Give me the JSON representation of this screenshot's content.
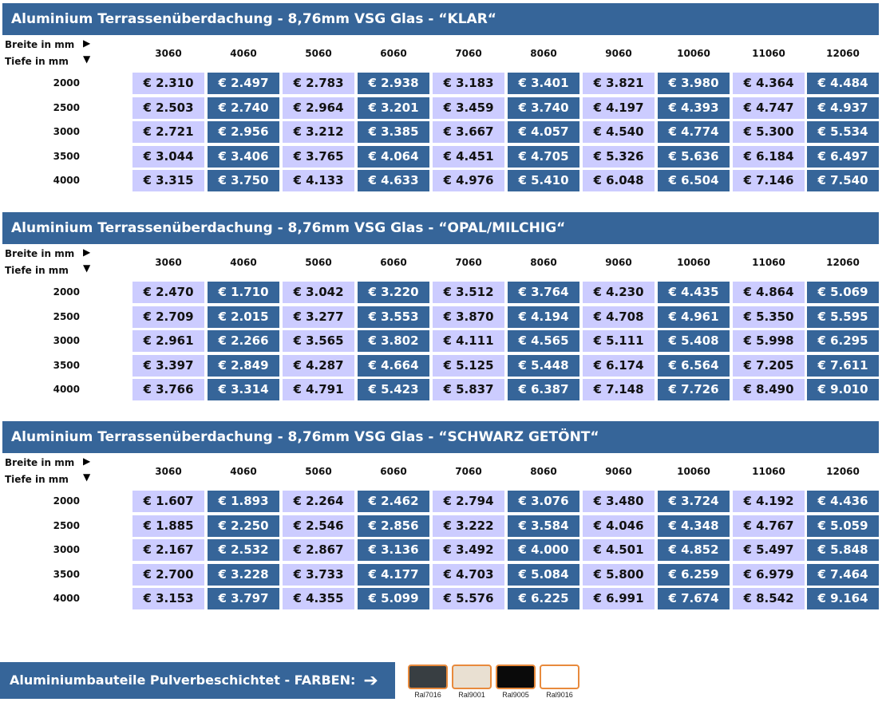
{
  "sections": [
    {
      "title": "Aluminium Terrassenüberdachung - 8,76mm VSG Glas - “KLAR“",
      "breite_label": "Breite in mm",
      "tiefe_label": "Tiefe in mm",
      "widths": [
        "3060",
        "4060",
        "5060",
        "6060",
        "7060",
        "8060",
        "9060",
        "10060",
        "11060",
        "12060"
      ],
      "rows": [
        {
          "depth": "2000",
          "prices": [
            "€ 2.310",
            "€ 2.497",
            "€ 2.783",
            "€ 2.938",
            "€ 3.183",
            "€ 3.401",
            "€ 3.821",
            "€ 3.980",
            "€ 4.364",
            "€ 4.484"
          ]
        },
        {
          "depth": "2500",
          "prices": [
            "€ 2.503",
            "€ 2.740",
            "€ 2.964",
            "€ 3.201",
            "€ 3.459",
            "€ 3.740",
            "€ 4.197",
            "€ 4.393",
            "€ 4.747",
            "€ 4.937"
          ]
        },
        {
          "depth": "3000",
          "prices": [
            "€ 2.721",
            "€ 2.956",
            "€ 3.212",
            "€ 3.385",
            "€ 3.667",
            "€ 4.057",
            "€ 4.540",
            "€ 4.774",
            "€ 5.300",
            "€ 5.534"
          ]
        },
        {
          "depth": "3500",
          "prices": [
            "€ 3.044",
            "€ 3.406",
            "€ 3.765",
            "€ 4.064",
            "€ 4.451",
            "€ 4.705",
            "€ 5.326",
            "€ 5.636",
            "€ 6.184",
            "€ 6.497"
          ]
        },
        {
          "depth": "4000",
          "prices": [
            "€ 3.315",
            "€ 3.750",
            "€ 4.133",
            "€ 4.633",
            "€ 4.976",
            "€ 5.410",
            "€ 6.048",
            "€ 6.504",
            "€ 7.146",
            "€ 7.540"
          ]
        }
      ]
    },
    {
      "title": "Aluminium Terrassenüberdachung - 8,76mm VSG Glas - “OPAL/MILCHIG“",
      "breite_label": "Breite in mm",
      "tiefe_label": "Tiefe in mm",
      "widths": [
        "3060",
        "4060",
        "5060",
        "6060",
        "7060",
        "8060",
        "9060",
        "10060",
        "11060",
        "12060"
      ],
      "rows": [
        {
          "depth": "2000",
          "prices": [
            "€ 2.470",
            "€ 1.710",
            "€ 3.042",
            "€ 3.220",
            "€ 3.512",
            "€ 3.764",
            "€ 4.230",
            "€ 4.435",
            "€ 4.864",
            "€ 5.069"
          ]
        },
        {
          "depth": "2500",
          "prices": [
            "€ 2.709",
            "€ 2.015",
            "€ 3.277",
            "€ 3.553",
            "€ 3.870",
            "€ 4.194",
            "€ 4.708",
            "€ 4.961",
            "€ 5.350",
            "€ 5.595"
          ]
        },
        {
          "depth": "3000",
          "prices": [
            "€ 2.961",
            "€ 2.266",
            "€ 3.565",
            "€ 3.802",
            "€ 4.111",
            "€ 4.565",
            "€ 5.111",
            "€ 5.408",
            "€ 5.998",
            "€ 6.295"
          ]
        },
        {
          "depth": "3500",
          "prices": [
            "€ 3.397",
            "€ 2.849",
            "€ 4.287",
            "€ 4.664",
            "€ 5.125",
            "€ 5.448",
            "€ 6.174",
            "€ 6.564",
            "€ 7.205",
            "€ 7.611"
          ]
        },
        {
          "depth": "4000",
          "prices": [
            "€ 3.766",
            "€ 3.314",
            "€ 4.791",
            "€ 5.423",
            "€ 5.837",
            "€ 6.387",
            "€ 7.148",
            "€ 7.726",
            "€ 8.490",
            "€ 9.010"
          ]
        }
      ]
    },
    {
      "title": "Aluminium Terrassenüberdachung - 8,76mm VSG Glas - “SCHWARZ GETÖNT“",
      "breite_label": "Breite in mm",
      "tiefe_label": "Tiefe in mm",
      "widths": [
        "3060",
        "4060",
        "5060",
        "6060",
        "7060",
        "8060",
        "9060",
        "10060",
        "11060",
        "12060"
      ],
      "rows": [
        {
          "depth": "2000",
          "prices": [
            "€ 1.607",
            "€ 1.893",
            "€ 2.264",
            "€ 2.462",
            "€ 2.794",
            "€ 3.076",
            "€ 3.480",
            "€ 3.724",
            "€ 4.192",
            "€ 4.436"
          ]
        },
        {
          "depth": "2500",
          "prices": [
            "€ 1.885",
            "€ 2.250",
            "€ 2.546",
            "€ 2.856",
            "€ 3.222",
            "€ 3.584",
            "€ 4.046",
            "€ 4.348",
            "€ 4.767",
            "€ 5.059"
          ]
        },
        {
          "depth": "3000",
          "prices": [
            "€ 2.167",
            "€ 2.532",
            "€ 2.867",
            "€ 3.136",
            "€ 3.492",
            "€ 4.000",
            "€ 4.501",
            "€ 4.852",
            "€ 5.497",
            "€ 5.848"
          ]
        },
        {
          "depth": "3500",
          "prices": [
            "€ 2.700",
            "€ 3.228",
            "€ 3.733",
            "€ 4.177",
            "€ 4.703",
            "€ 5.084",
            "€ 5.800",
            "€ 6.259",
            "€ 6.979",
            "€ 7.464"
          ]
        },
        {
          "depth": "4000",
          "prices": [
            "€ 3.153",
            "€ 3.797",
            "€ 4.355",
            "€ 5.099",
            "€ 5.576",
            "€ 6.225",
            "€ 6.991",
            "€ 7.674",
            "€ 8.542",
            "€ 9.164"
          ]
        }
      ]
    }
  ],
  "footer": {
    "title": "Aluminiumbauteile Pulverbeschichtet - FARBEN:",
    "arrow_icon": "right-arrow-icon",
    "swatches": [
      {
        "label": "Ral7016",
        "color": "#383e42"
      },
      {
        "label": "Ral9001",
        "color": "#e9e0d2"
      },
      {
        "label": "Ral9005",
        "color": "#0a0a0a"
      },
      {
        "label": "Ral9016",
        "color": "#ffffff"
      }
    ]
  },
  "colors": {
    "banner": "#366599",
    "cell_light": "#ccccff",
    "cell_dark": "#366599",
    "swatch_border": "#e88a3c"
  }
}
